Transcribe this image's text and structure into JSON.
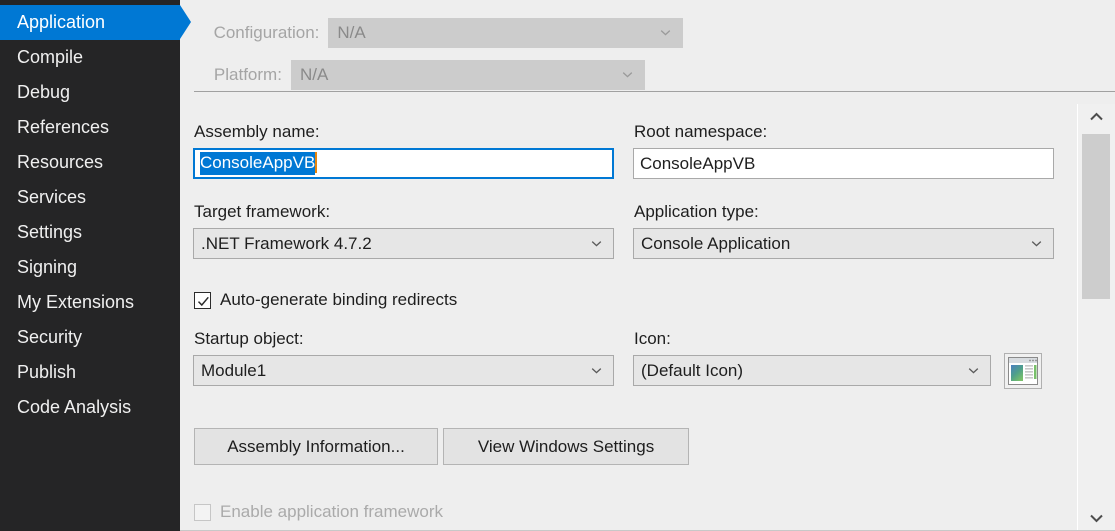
{
  "sidebar": {
    "items": [
      {
        "label": "Application",
        "selected": true
      },
      {
        "label": "Compile",
        "selected": false
      },
      {
        "label": "Debug",
        "selected": false
      },
      {
        "label": "References",
        "selected": false
      },
      {
        "label": "Resources",
        "selected": false
      },
      {
        "label": "Services",
        "selected": false
      },
      {
        "label": "Settings",
        "selected": false
      },
      {
        "label": "Signing",
        "selected": false
      },
      {
        "label": "My Extensions",
        "selected": false
      },
      {
        "label": "Security",
        "selected": false
      },
      {
        "label": "Publish",
        "selected": false
      },
      {
        "label": "Code Analysis",
        "selected": false
      }
    ]
  },
  "header": {
    "configuration_label": "Configuration:",
    "configuration_value": "N/A",
    "platform_label": "Platform:",
    "platform_value": "N/A"
  },
  "main": {
    "assembly_name_label": "Assembly name:",
    "assembly_name_value": "ConsoleAppVB",
    "root_namespace_label": "Root namespace:",
    "root_namespace_value": "ConsoleAppVB",
    "target_framework_label": "Target framework:",
    "target_framework_value": ".NET Framework 4.7.2",
    "application_type_label": "Application type:",
    "application_type_value": "Console Application",
    "binding_redirects_label": "Auto-generate binding redirects",
    "startup_object_label": "Startup object:",
    "startup_object_value": "Module1",
    "icon_label": "Icon:",
    "icon_value": "(Default Icon)",
    "assembly_information_button": "Assembly Information...",
    "view_windows_settings_button": "View Windows Settings",
    "enable_application_framework_label": "Enable application framework"
  },
  "colors": {
    "accent": "#0078d4",
    "sidebar_bg": "#252526",
    "content_bg": "#eeeeee",
    "caret": "#e8850c"
  }
}
